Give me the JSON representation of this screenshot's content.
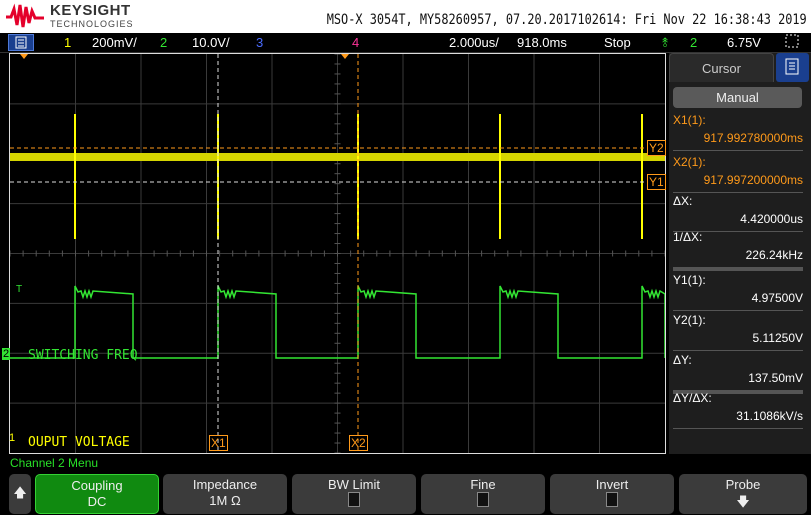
{
  "header": {
    "brand": "KEYSIGHT",
    "brand_sub": "TECHNOLOGIES",
    "instrument": "MSO-X 3054T, MY58260957, 07.20.2017102614: Fri Nov 22 16:38:43 2019"
  },
  "status": {
    "ch1_num": "1",
    "ch1_scale": "200mV/",
    "ch2_num": "2",
    "ch2_scale": "10.0V/",
    "ch3_num": "3",
    "ch4_num": "4",
    "timebase": "2.000us/",
    "delay": "918.0ms",
    "run_state": "Stop",
    "trig_src": "2",
    "trig_level": "6.75V"
  },
  "plot": {
    "ch2_label": "SWITCHING FREQ",
    "ch1_label": "OUPUT VOLTAGE",
    "x1": "X1",
    "x2": "X2",
    "y1": "Y1",
    "y2": "Y2",
    "ch1_marker": "1",
    "ch2_marker": "2",
    "trig_marker": "T"
  },
  "cursor_panel": {
    "tab": "Cursor",
    "mode": "Manual",
    "rows": [
      {
        "label": "X1(1):",
        "value": "917.992780000ms"
      },
      {
        "label": "X2(1):",
        "value": "917.997200000ms"
      },
      {
        "label": "ΔX:",
        "value": "4.420000us"
      },
      {
        "label": "1/ΔX:",
        "value": "226.24kHz"
      },
      {
        "label": "Y1(1):",
        "value": "4.97500V"
      },
      {
        "label": "Y2(1):",
        "value": "5.11250V"
      },
      {
        "label": "ΔY:",
        "value": "137.50mV"
      },
      {
        "label": "ΔY/ΔX:",
        "value": "31.1086kV/s"
      }
    ]
  },
  "softkeys": {
    "menu_title": "Channel 2 Menu",
    "coupling": "Coupling",
    "coupling_val": "DC",
    "impedance": "Impedance",
    "impedance_val": "1M Ω",
    "bw_limit": "BW Limit",
    "fine": "Fine",
    "invert": "Invert",
    "probe": "Probe"
  },
  "colors": {
    "ch1": "#ffff00",
    "ch2": "#33e633",
    "ch4": "#ff3399",
    "cursor": "#ff9a1a",
    "trigger": "#33e633"
  }
}
